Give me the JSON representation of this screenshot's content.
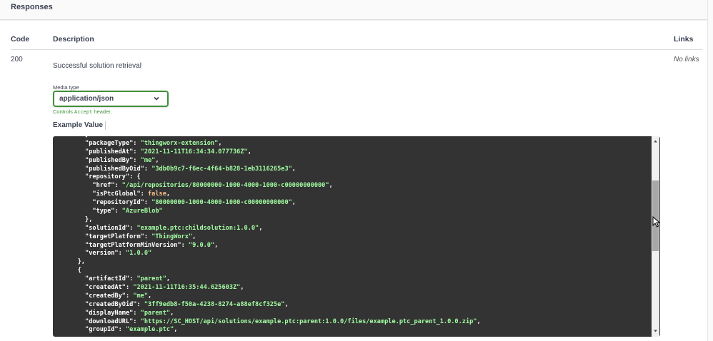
{
  "section": {
    "title": "Responses"
  },
  "table": {
    "headers": {
      "code": "Code",
      "description": "Description",
      "links": "Links"
    },
    "row": {
      "code": "200",
      "description": "Successful solution retrieval",
      "links": "No links"
    }
  },
  "media_type": {
    "label": "Media type",
    "selected": "application/json",
    "note_prefix": "Controls ",
    "note_code": "Accept",
    "note_suffix": " header."
  },
  "example": {
    "tab_label": "Example Value"
  },
  "code_lines": [
    [
      {
        "t": "      }",
        "c": "p"
      }
    ],
    [
      {
        "t": "      \"packageType\": ",
        "c": "k"
      },
      {
        "t": "\"thingworx-extension\"",
        "c": "s"
      },
      {
        "t": ",",
        "c": "p"
      }
    ],
    [
      {
        "t": "      \"publishedAt\": ",
        "c": "k"
      },
      {
        "t": "\"2021-11-11T16:34:34.077736Z\"",
        "c": "s"
      },
      {
        "t": ",",
        "c": "p"
      }
    ],
    [
      {
        "t": "      \"publishedBy\": ",
        "c": "k"
      },
      {
        "t": "\"me\"",
        "c": "s"
      },
      {
        "t": ",",
        "c": "p"
      }
    ],
    [
      {
        "t": "      \"publishedByOid\": ",
        "c": "k"
      },
      {
        "t": "\"3db0b9c7-f6ec-4f64-b828-1eb3116265e3\"",
        "c": "s"
      },
      {
        "t": ",",
        "c": "p"
      }
    ],
    [
      {
        "t": "      \"repository\": {",
        "c": "k"
      }
    ],
    [
      {
        "t": "        \"href\": ",
        "c": "k"
      },
      {
        "t": "\"/api/repositories/80000000-1000-4000-1000-c00000000000\"",
        "c": "s"
      },
      {
        "t": ",",
        "c": "p"
      }
    ],
    [
      {
        "t": "        \"isPtcGlobal\": ",
        "c": "k"
      },
      {
        "t": "false",
        "c": "b"
      },
      {
        "t": ",",
        "c": "p"
      }
    ],
    [
      {
        "t": "        \"repositoryId\": ",
        "c": "k"
      },
      {
        "t": "\"80000000-1000-4000-1000-c00000000000\"",
        "c": "s"
      },
      {
        "t": ",",
        "c": "p"
      }
    ],
    [
      {
        "t": "        \"type\": ",
        "c": "k"
      },
      {
        "t": "\"AzureBlob\"",
        "c": "s"
      }
    ],
    [
      {
        "t": "      },",
        "c": "p"
      }
    ],
    [
      {
        "t": "      \"solutionId\": ",
        "c": "k"
      },
      {
        "t": "\"example.ptc:childsolution:1.0.0\"",
        "c": "s"
      },
      {
        "t": ",",
        "c": "p"
      }
    ],
    [
      {
        "t": "      \"targetPlatform\": ",
        "c": "k"
      },
      {
        "t": "\"ThingWorx\"",
        "c": "s"
      },
      {
        "t": ",",
        "c": "p"
      }
    ],
    [
      {
        "t": "      \"targetPlatformMinVersion\": ",
        "c": "k"
      },
      {
        "t": "\"9.0.0\"",
        "c": "s"
      },
      {
        "t": ",",
        "c": "p"
      }
    ],
    [
      {
        "t": "      \"version\": ",
        "c": "k"
      },
      {
        "t": "\"1.0.0\"",
        "c": "s"
      }
    ],
    [
      {
        "t": "    },",
        "c": "p"
      }
    ],
    [
      {
        "t": "    {",
        "c": "p"
      }
    ],
    [
      {
        "t": "      \"artifactId\": ",
        "c": "k"
      },
      {
        "t": "\"parent\"",
        "c": "s"
      },
      {
        "t": ",",
        "c": "p"
      }
    ],
    [
      {
        "t": "      \"createdAt\": ",
        "c": "k"
      },
      {
        "t": "\"2021-11-11T16:35:44.625603Z\"",
        "c": "s"
      },
      {
        "t": ",",
        "c": "p"
      }
    ],
    [
      {
        "t": "      \"createdBy\": ",
        "c": "k"
      },
      {
        "t": "\"me\"",
        "c": "s"
      },
      {
        "t": ",",
        "c": "p"
      }
    ],
    [
      {
        "t": "      \"createdByOid\": ",
        "c": "k"
      },
      {
        "t": "\"3ff9edb8-f50a-4238-8274-a88ef8cf325e\"",
        "c": "s"
      },
      {
        "t": ",",
        "c": "p"
      }
    ],
    [
      {
        "t": "      \"displayName\": ",
        "c": "k"
      },
      {
        "t": "\"parent\"",
        "c": "s"
      },
      {
        "t": ",",
        "c": "p"
      }
    ],
    [
      {
        "t": "      \"downloadURL\": ",
        "c": "k"
      },
      {
        "t": "\"https://SC_HOST/api/solutions/example.ptc:parent:1.0.0/files/example.ptc_parent_1.0.0.zip\"",
        "c": "s"
      },
      {
        "t": ",",
        "c": "p"
      }
    ],
    [
      {
        "t": "      \"groupId\": ",
        "c": "k"
      },
      {
        "t": "\"example.ptc\"",
        "c": "s"
      },
      {
        "t": ",",
        "c": "p"
      }
    ]
  ],
  "scrollbar": {
    "position_fraction": 0.32
  },
  "icons": {
    "chevron": "chevron-down-icon",
    "scroll_up": "scroll-up-arrow-icon",
    "scroll_down": "scroll-down-arrow-icon",
    "cursor": "mouse-pointer-icon"
  },
  "colors": {
    "accent_green": "#41903a",
    "code_background": "#333333",
    "json_string": "#a2fca2",
    "json_boolean": "#fcc28c"
  }
}
